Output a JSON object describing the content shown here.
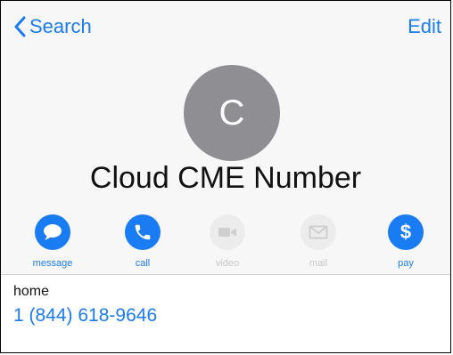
{
  "nav": {
    "back_label": "Search",
    "edit_label": "Edit"
  },
  "contact": {
    "initial": "C",
    "name": "Cloud CME Number"
  },
  "actions": [
    {
      "label": "message",
      "enabled": true,
      "icon": "message-bubble-icon"
    },
    {
      "label": "call",
      "enabled": true,
      "icon": "phone-icon"
    },
    {
      "label": "video",
      "enabled": false,
      "icon": "video-camera-icon"
    },
    {
      "label": "mail",
      "enabled": false,
      "icon": "envelope-icon"
    },
    {
      "label": "pay",
      "enabled": true,
      "icon": "dollar-icon"
    }
  ],
  "phone": {
    "label": "home",
    "number": "1 (844) 618-9646"
  },
  "colors": {
    "accent": "#1a7cf2",
    "avatar": "#8e8e93",
    "disabled": "#c8c8c8",
    "header_bg": "#f7f7f7"
  }
}
